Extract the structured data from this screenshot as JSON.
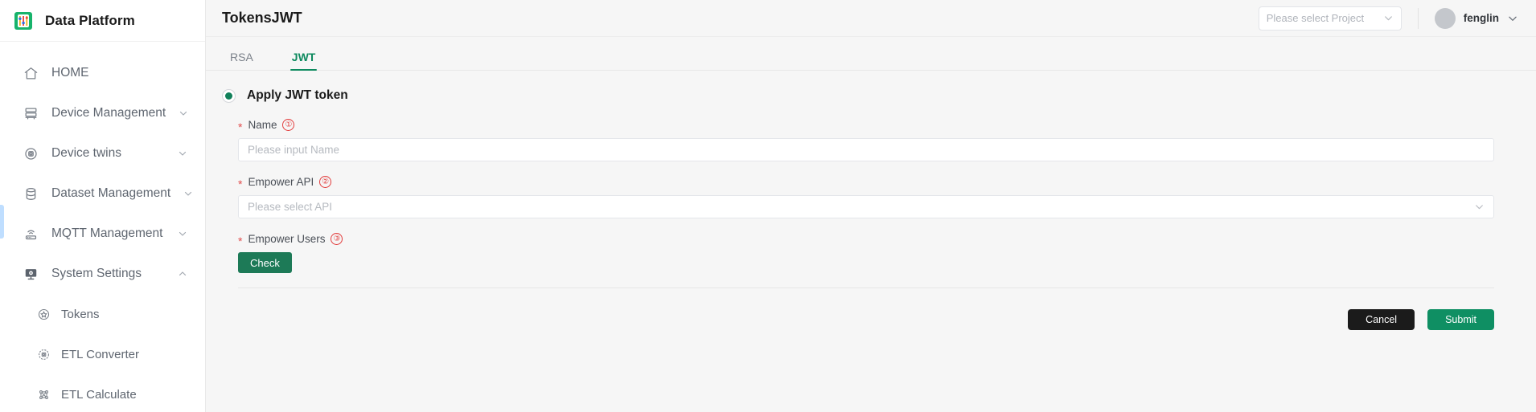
{
  "brand": {
    "name": "Data Platform",
    "logo_icon": "data-platform-logo-icon"
  },
  "sidebar": {
    "items": [
      {
        "label": "HOME",
        "icon": "home-icon",
        "has_chevron": false,
        "sub": false
      },
      {
        "label": "Device Management",
        "icon": "server-rack-icon",
        "has_chevron": true,
        "sub": false
      },
      {
        "label": "Device twins",
        "icon": "device-twin-icon",
        "has_chevron": true,
        "sub": false
      },
      {
        "label": "Dataset Management",
        "icon": "database-icon",
        "has_chevron": true,
        "sub": false
      },
      {
        "label": "MQTT Management",
        "icon": "router-signal-icon",
        "has_chevron": true,
        "sub": false
      },
      {
        "label": "System Settings",
        "icon": "monitor-gear-icon",
        "has_chevron": true,
        "sub": false,
        "expanded": true
      },
      {
        "label": "Tokens",
        "icon": "token-star-icon",
        "has_chevron": false,
        "sub": true,
        "active": true
      },
      {
        "label": "ETL Converter",
        "icon": "etl-converter-icon",
        "has_chevron": false,
        "sub": true
      },
      {
        "label": "ETL Calculate",
        "icon": "etl-calculate-icon",
        "has_chevron": false,
        "sub": true
      }
    ]
  },
  "header": {
    "title": "TokensJWT",
    "project_select": {
      "placeholder": "Please select Project",
      "icon": "chevron-down-icon"
    },
    "user": {
      "name": "fenglin",
      "avatar_icon": "avatar-icon",
      "menu_icon": "chevron-down-icon"
    }
  },
  "tabs": [
    {
      "label": "RSA",
      "active": false
    },
    {
      "label": "JWT",
      "active": true
    }
  ],
  "form": {
    "radio_label": "Apply JWT token",
    "fields": [
      {
        "label": "Name",
        "badge": "①",
        "required": true,
        "type": "input",
        "placeholder": "Please input Name",
        "value": ""
      },
      {
        "label": "Empower API",
        "badge": "②",
        "required": true,
        "type": "select",
        "placeholder": "Please select API",
        "value": ""
      },
      {
        "label": "Empower Users",
        "badge": "③",
        "required": true,
        "type": "button",
        "button_label": "Check"
      }
    ]
  },
  "actions": {
    "cancel_label": "Cancel",
    "submit_label": "Submit"
  },
  "colors": {
    "brand_green": "#0e8a5f",
    "check_green": "#1d7a57",
    "submit_green": "#0f8f63",
    "cancel_black": "#1b1b1b",
    "required_red": "#e23b3b",
    "active_bar_blue": "#bfdeff"
  }
}
